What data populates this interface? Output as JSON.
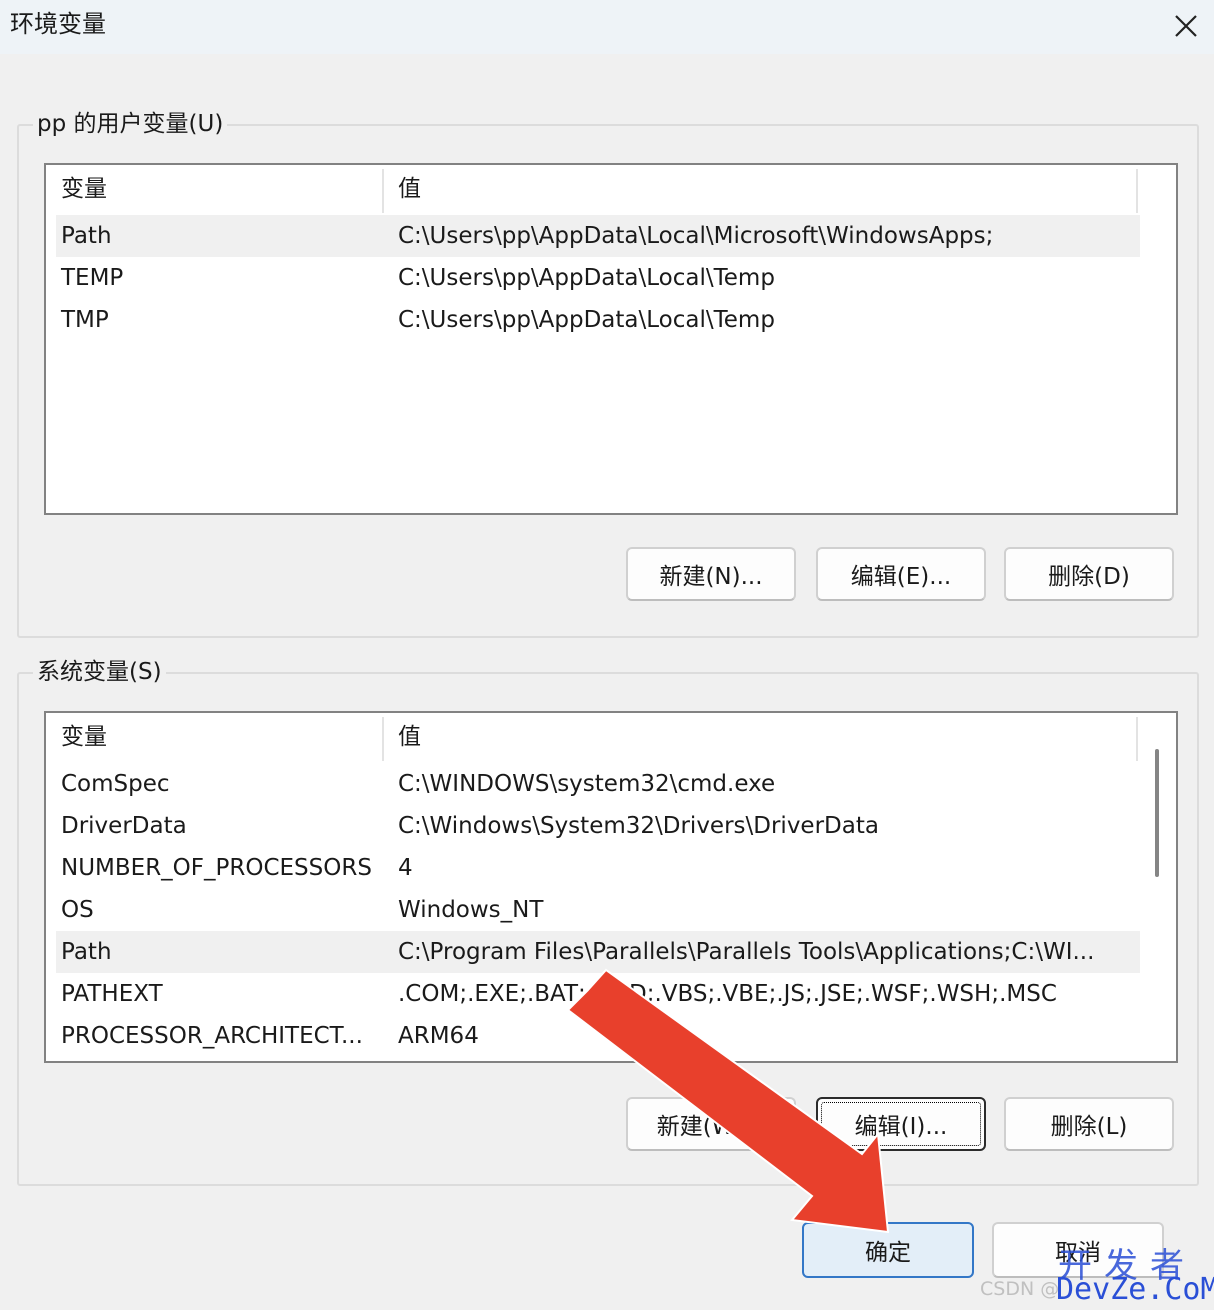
{
  "window": {
    "title": "环境变量",
    "close_icon": "close-icon"
  },
  "user_vars": {
    "group_label": "pp 的用户变量(U)",
    "col_name": "变量",
    "col_value": "值",
    "rows": [
      {
        "name": "Path",
        "value": "C:\\Users\\pp\\AppData\\Local\\Microsoft\\WindowsApps;",
        "selected": true
      },
      {
        "name": "TEMP",
        "value": "C:\\Users\\pp\\AppData\\Local\\Temp",
        "selected": false
      },
      {
        "name": "TMP",
        "value": "C:\\Users\\pp\\AppData\\Local\\Temp",
        "selected": false
      }
    ],
    "buttons": {
      "new": "新建(N)...",
      "edit": "编辑(E)...",
      "delete": "删除(D)"
    }
  },
  "system_vars": {
    "group_label": "系统变量(S)",
    "col_name": "变量",
    "col_value": "值",
    "rows": [
      {
        "name": "ComSpec",
        "value": "C:\\WINDOWS\\system32\\cmd.exe",
        "selected": false
      },
      {
        "name": "DriverData",
        "value": "C:\\Windows\\System32\\Drivers\\DriverData",
        "selected": false
      },
      {
        "name": "NUMBER_OF_PROCESSORS",
        "value": "4",
        "selected": false
      },
      {
        "name": "OS",
        "value": "Windows_NT",
        "selected": false
      },
      {
        "name": "Path",
        "value": "C:\\Program Files\\Parallels\\Parallels Tools\\Applications;C:\\WI...",
        "selected": true
      },
      {
        "name": "PATHEXT",
        "value": ".COM;.EXE;.BAT;.CMD;.VBS;.VBE;.JS;.JSE;.WSF;.WSH;.MSC",
        "selected": false
      },
      {
        "name": "PROCESSOR_ARCHITECT...",
        "value": "ARM64",
        "selected": false
      }
    ],
    "buttons": {
      "new": "新建(W)...",
      "edit": "编辑(I)...",
      "delete": "删除(L)"
    }
  },
  "footer": {
    "ok": "确定",
    "cancel": "取消"
  },
  "annotation": {
    "arrow_color": "#e8402c"
  },
  "watermark": {
    "csdn": "CSDN @",
    "logo_top": "开发者",
    "logo_bottom": "DevZe.CoM"
  },
  "colors": {
    "accent": "#3377c7",
    "selected_row": "#f0f0f0"
  }
}
